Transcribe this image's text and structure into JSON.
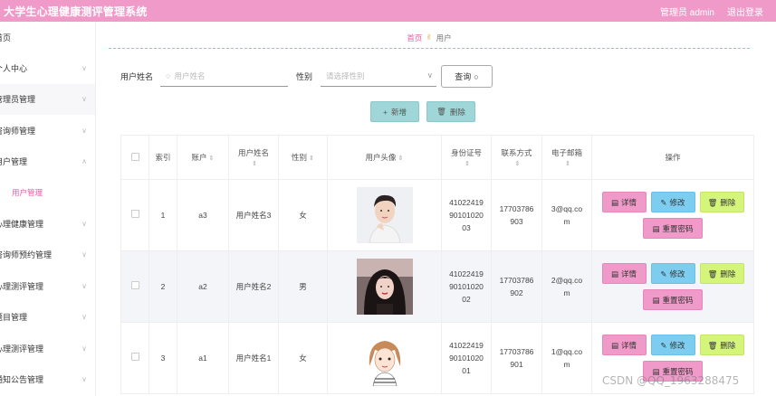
{
  "header": {
    "title": "大学生心理健康测评管理系统",
    "admin_label": "管理员 admin",
    "logout_label": "退出登录"
  },
  "sidebar": {
    "items": [
      {
        "label": "首页",
        "has_chevron": false
      },
      {
        "label": "个人中心",
        "has_chevron": true
      },
      {
        "label": "管理员管理",
        "has_chevron": true
      },
      {
        "label": "咨询师管理",
        "has_chevron": true
      },
      {
        "label": "用户管理",
        "has_chevron": true,
        "expanded": true
      },
      {
        "label": "心理健康管理",
        "has_chevron": true
      },
      {
        "label": "咨询师预约管理",
        "has_chevron": true
      },
      {
        "label": "心理测评管理",
        "has_chevron": true
      },
      {
        "label": "题目管理",
        "has_chevron": true
      },
      {
        "label": "心理测评管理",
        "has_chevron": true
      },
      {
        "label": "通知公告管理",
        "has_chevron": true
      }
    ],
    "submenu_label": "用户管理"
  },
  "breadcrumb": {
    "home": "首页",
    "current": "用户"
  },
  "search": {
    "name_label": "用户姓名",
    "name_placeholder": "用户姓名",
    "gender_label": "性别",
    "gender_placeholder": "请选择性别",
    "query_label": "查询"
  },
  "actions": {
    "add_label": "新增",
    "delete_label": "删除"
  },
  "table": {
    "headers": [
      "索引",
      "账户",
      "用户姓名",
      "性别",
      "用户头像",
      "身份证号",
      "联系方式",
      "电子邮箱",
      "操作"
    ],
    "rows": [
      {
        "index": "1",
        "account": "a3",
        "name": "用户姓名3",
        "gender": "女",
        "id_lines": [
          "41022419",
          "90101020",
          "03"
        ],
        "phone_lines": [
          "17703786",
          "903"
        ],
        "email_lines": [
          "3@qq.co",
          "m"
        ],
        "avatar": "male-portrait"
      },
      {
        "index": "2",
        "account": "a2",
        "name": "用户姓名2",
        "gender": "男",
        "id_lines": [
          "41022419",
          "90101020",
          "02"
        ],
        "phone_lines": [
          "17703786",
          "902"
        ],
        "email_lines": [
          "2@qq.co",
          "m"
        ],
        "avatar": "female-portrait"
      },
      {
        "index": "3",
        "account": "a1",
        "name": "用户姓名1",
        "gender": "女",
        "id_lines": [
          "41022419",
          "90101020",
          "01"
        ],
        "phone_lines": [
          "17703786",
          "901"
        ],
        "email_lines": [
          "1@qq.co",
          "m"
        ],
        "avatar": "cartoon-girl"
      }
    ],
    "op_labels": {
      "detail": "详情",
      "edit": "修改",
      "remove": "删除",
      "reset": "重置密码"
    }
  },
  "colors": {
    "primary_pink": "#f09ac9",
    "teal": "#9fd7d8",
    "blue": "#7dcdf0",
    "lime": "#d4f57a"
  },
  "watermark": "CSDN @QQ_1963288475"
}
